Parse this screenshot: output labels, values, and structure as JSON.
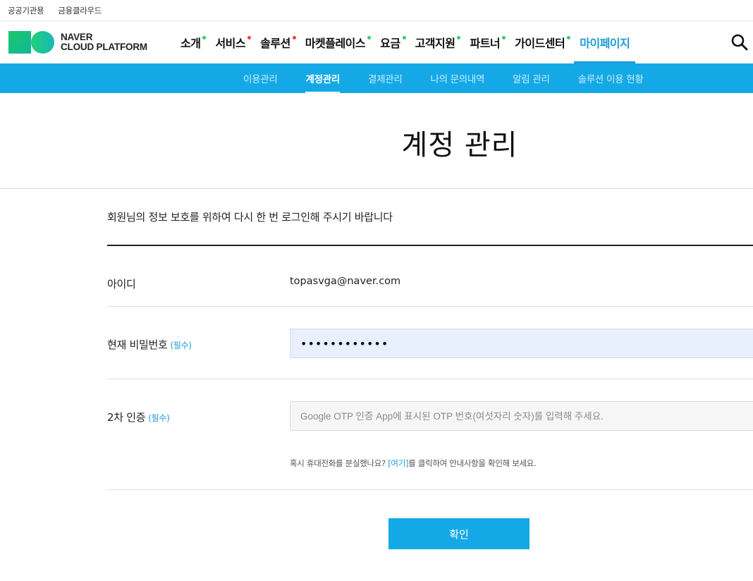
{
  "util_bar": {
    "links": [
      "공공기관용",
      "금융클라우드"
    ]
  },
  "logo": {
    "line1": "NAVER",
    "line2": "CLOUD PLATFORM"
  },
  "gnb": {
    "items": [
      {
        "label": "소개",
        "dot": "#3cc96b"
      },
      {
        "label": "서비스",
        "dot": "#f0413b"
      },
      {
        "label": "솔루션",
        "dot": "#f0413b"
      },
      {
        "label": "마켓플레이스",
        "dot": "#3cc96b"
      },
      {
        "label": "요금",
        "dot": "#3cc96b"
      },
      {
        "label": "고객지원",
        "dot": "#3cc96b"
      },
      {
        "label": "파트너",
        "dot": "#3cc96b"
      },
      {
        "label": "가이드센터",
        "dot": "#3cc96b"
      },
      {
        "label": "마이페이지",
        "dot": null
      }
    ],
    "active_index": 8,
    "search_icon": "search-icon"
  },
  "subnav": {
    "items": [
      "이용관리",
      "계정관리",
      "결제관리",
      "나의 문의내역",
      "알림 관리",
      "솔루션 이용 현황"
    ],
    "active_index": 1
  },
  "page": {
    "title": "계정 관리"
  },
  "form": {
    "notice": "회원님의 정보 보호를 위하여 다시 한 번 로그인해 주시기 바랍니다",
    "id_label": "아이디",
    "id_value": "topasvga@naver.com",
    "pw_label": "현재 비밀번호",
    "required": "(필수)",
    "pw_value": "••••••••••••",
    "otp_label": "2차 인증",
    "otp_placeholder": "Google OTP 인증 App에 표시된 OTP 번호(여섯자리 숫자)를 입력해 주세요.",
    "otp_help_before": "혹시 휴대전화를 분실했나요? ",
    "otp_help_link": "[여기]",
    "otp_help_after": "를 클릭하여 안내사항을 확인해 보세요.",
    "confirm_label": "확인"
  },
  "colors": {
    "brand_blue": "#14a9e6",
    "active_text": "#1b9bd7",
    "required": "#1b9bd7"
  }
}
